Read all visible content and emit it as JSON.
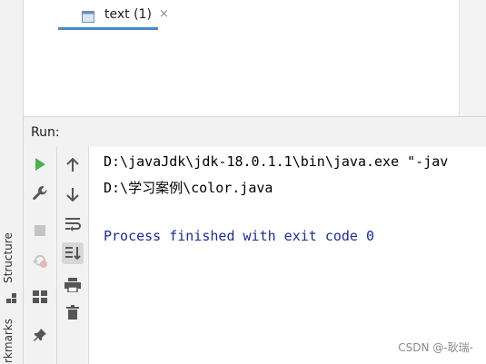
{
  "sidebar": {
    "structure_label": "Structure",
    "bookmarks_label": "rkmarks"
  },
  "run_panel": {
    "title": "Run:",
    "tab_label": "text (1)",
    "tab_close": "×"
  },
  "console": {
    "lines": [
      "D:\\javaJdk\\jdk-18.0.1.1\\bin\\java.exe \"-jav",
      "D:\\学习案例\\color.java",
      "Process finished with exit code 0"
    ]
  },
  "watermark": "CSDN @-耿瑞-",
  "colors": {
    "accent": "#4a88c7",
    "run_green": "#4caf50",
    "process_text": "#1b2b9a"
  },
  "icons": {
    "column1": [
      "run-icon",
      "wrench-icon",
      "stop-icon",
      "rerun-failed-icon",
      "layout-icon",
      "pin-icon"
    ],
    "column2": [
      "arrow-up-icon",
      "arrow-down-icon",
      "soft-wrap-icon",
      "scroll-to-end-icon",
      "print-icon",
      "trash-icon"
    ]
  }
}
